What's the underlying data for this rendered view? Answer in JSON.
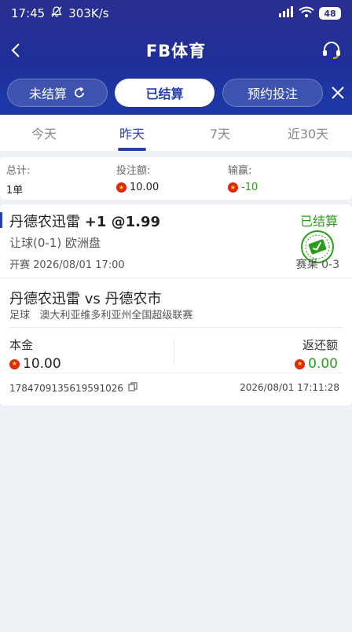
{
  "status_bar": {
    "time": "17:45",
    "net_speed": "303K/s",
    "battery": "48"
  },
  "header": {
    "title": "FB体育"
  },
  "filters": [
    {
      "label": "未结算"
    },
    {
      "label": "已结算"
    },
    {
      "label": "预约投注"
    }
  ],
  "date_tabs": [
    "今天",
    "昨天",
    "7天",
    "近30天"
  ],
  "summary": {
    "total_label": "总计:",
    "total_value": "1单",
    "stake_label": "投注额:",
    "stake_value": "10.00",
    "winloss_label": "输赢:",
    "winloss_value": "-10"
  },
  "bet": {
    "selection": "丹德农迅雷",
    "handicap": "+1 @1.99",
    "status": "已结算",
    "market": "让球(0-1) 欧洲盘",
    "kickoff_label": "开赛",
    "kickoff_time": "2026/08/01 17:00",
    "result": "赛果 0-3",
    "match": "丹德农迅雷 vs 丹德农市",
    "sport": "足球",
    "league": "澳大利亚维多利亚州全国超级联赛",
    "stake_label": "本金",
    "stake_value": "10.00",
    "return_label": "返还额",
    "return_value": "0.00",
    "order_id": "1784709135619591026",
    "bet_time": "2026/08/01 17:11:28"
  },
  "colors": {
    "brand": "#2a3fa8",
    "header_bg": "#2a2f8f",
    "win": "#2a9d1a"
  }
}
